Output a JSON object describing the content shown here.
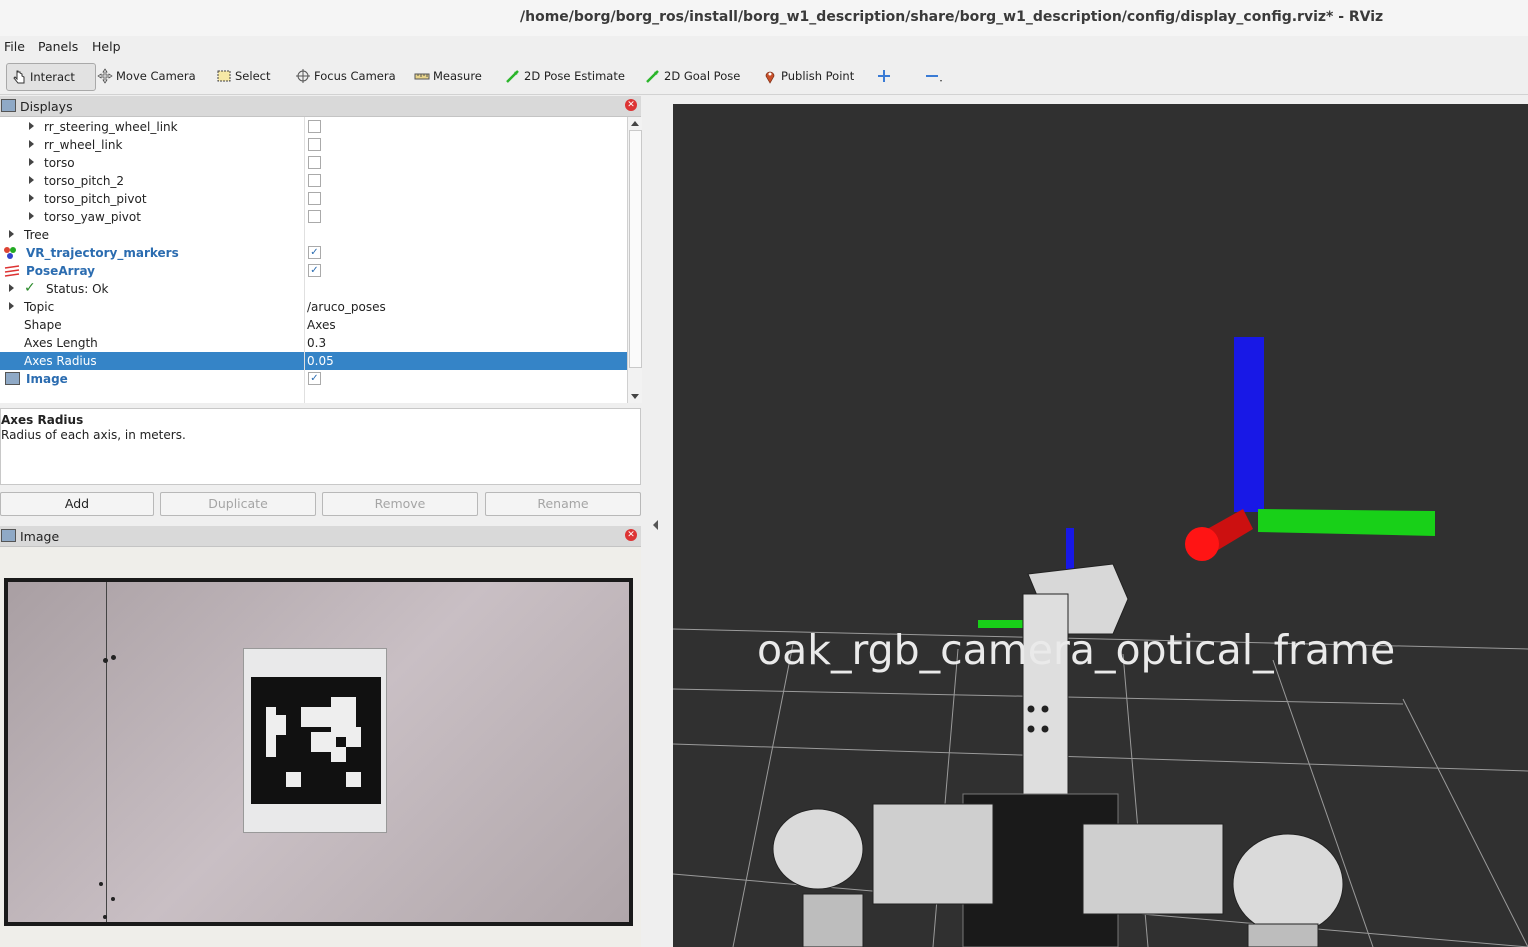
{
  "window": {
    "title": "/home/borg/borg_ros/install/borg_w1_description/share/borg_w1_description/config/display_config.rviz* - RViz"
  },
  "menu": [
    "File",
    "Panels",
    "Help"
  ],
  "toolbar": {
    "interact": "Interact",
    "move_camera": "Move Camera",
    "select": "Select",
    "focus_camera": "Focus Camera",
    "measure": "Measure",
    "pose_estimate": "2D Pose Estimate",
    "goal_pose": "2D Goal Pose",
    "publish_point": "Publish Point"
  },
  "displays": {
    "title": "Displays",
    "rows": [
      {
        "label": "rr_steering_wheel_link",
        "checked": false
      },
      {
        "label": "rr_wheel_link",
        "checked": false
      },
      {
        "label": "torso",
        "checked": false
      },
      {
        "label": "torso_pitch_2",
        "checked": false
      },
      {
        "label": "torso_pitch_pivot",
        "checked": false
      },
      {
        "label": "torso_yaw_pivot",
        "checked": false
      },
      {
        "label": "Tree"
      },
      {
        "label": "VR_trajectory_markers",
        "checked": true
      },
      {
        "label": "PoseArray",
        "checked": true
      },
      {
        "label": "Status: Ok"
      },
      {
        "label": "Topic",
        "value": "/aruco_poses"
      },
      {
        "label": "Shape",
        "value": "Axes"
      },
      {
        "label": "Axes Length",
        "value": "0.3"
      },
      {
        "label": "Axes Radius",
        "value": "0.05"
      },
      {
        "label": "Image",
        "checked": true
      }
    ]
  },
  "description": {
    "title": "Axes Radius",
    "text": "Radius of each axis, in meters."
  },
  "buttons": {
    "add": "Add",
    "duplicate": "Duplicate",
    "remove": "Remove",
    "rename": "Rename"
  },
  "image_panel": {
    "title": "Image"
  },
  "view3d": {
    "frame_label": "oak_rgb_camera_optical_frame",
    "background": "#303030"
  }
}
